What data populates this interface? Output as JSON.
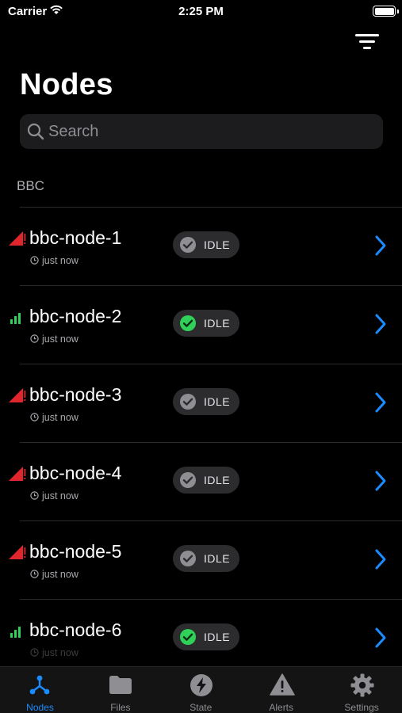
{
  "status_bar": {
    "carrier": "Carrier",
    "time": "2:25 PM"
  },
  "header": {
    "title": "Nodes",
    "filter_icon": "filter-icon"
  },
  "search": {
    "placeholder": "Search"
  },
  "section": {
    "title": "BBC"
  },
  "nodes": [
    {
      "name": "bbc-node-1",
      "time": "just now",
      "status": "IDLE",
      "status_active": false,
      "signal": "no-signal"
    },
    {
      "name": "bbc-node-2",
      "time": "just now",
      "status": "IDLE",
      "status_active": true,
      "signal": "full-signal"
    },
    {
      "name": "bbc-node-3",
      "time": "just now",
      "status": "IDLE",
      "status_active": false,
      "signal": "no-signal"
    },
    {
      "name": "bbc-node-4",
      "time": "just now",
      "status": "IDLE",
      "status_active": false,
      "signal": "no-signal"
    },
    {
      "name": "bbc-node-5",
      "time": "just now",
      "status": "IDLE",
      "status_active": false,
      "signal": "no-signal"
    },
    {
      "name": "bbc-node-6",
      "time": "just now",
      "status": "IDLE",
      "status_active": true,
      "signal": "full-signal"
    }
  ],
  "tabs": [
    {
      "label": "Nodes",
      "icon": "network-icon",
      "active": true
    },
    {
      "label": "Files",
      "icon": "folder-icon",
      "active": false
    },
    {
      "label": "State",
      "icon": "bolt-icon",
      "active": false
    },
    {
      "label": "Alerts",
      "icon": "warning-icon",
      "active": false
    },
    {
      "label": "Settings",
      "icon": "gear-icon",
      "active": false
    }
  ],
  "colors": {
    "accent": "#1a8cff",
    "status_active": "#30d158",
    "status_inactive": "#8e8e93",
    "signal_ok": "#30d158",
    "signal_lost": "#e0262d",
    "tab_inactive": "#8e8e93"
  }
}
